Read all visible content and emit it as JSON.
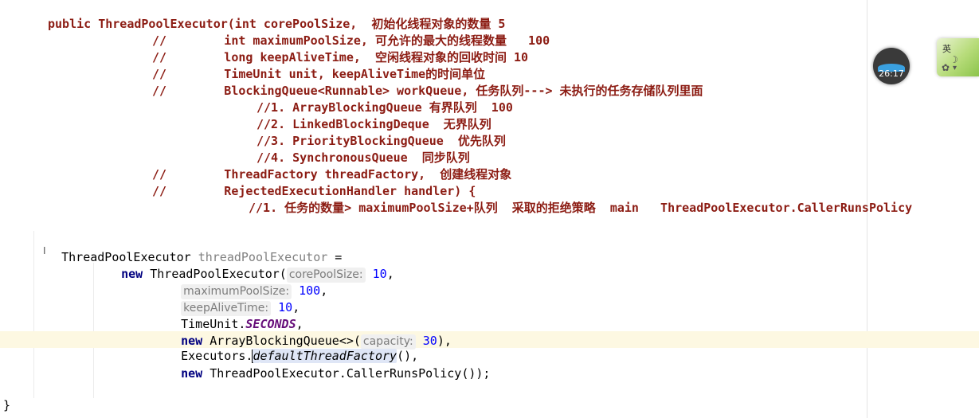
{
  "comment_block": [
    "public ThreadPoolExecutor(int corePoolSize,  初始化线程对象的数量 5",
    "//        int maximumPoolSize, 可允许的最大的线程数量   100",
    "//        long keepAliveTime,  空闲线程对象的回收时间 10",
    "//        TimeUnit unit, keepAliveTime的时间单位",
    "//        BlockingQueue<Runnable> workQueue, 任务队列---> 未执行的任务存储队列里面",
    "//1. ArrayBlockingQueue 有界队列  100",
    "//2. LinkedBlockingDeque  无界队列",
    "//3. PriorityBlockingQueue  优先队列",
    "//4. SynchronousQueue  同步队列",
    "//        ThreadFactory threadFactory,  创建线程对象",
    "//        RejectedExecutionHandler handler) {",
    "//1. 任务的数量> maximumPoolSize+队列  采取的拒绝策略  main   ThreadPoolExecutor.CallerRunsPolicy"
  ],
  "code": {
    "decl_type": "ThreadPoolExecutor",
    "decl_var": "threadPoolExecutor",
    "decl_eq": " =",
    "kw_new": "new",
    "ctor": "ThreadPoolExecutor(",
    "hint_core": "corePoolSize:",
    "val_core": "10",
    "hint_max": "maximumPoolSize:",
    "val_max": "100",
    "hint_keep": "keepAliveTime:",
    "val_keep": "10",
    "timeunit": "TimeUnit.",
    "timeunit_field": "SECONDS",
    "queue_class": "ArrayBlockingQueue<>(",
    "hint_capacity": "capacity:",
    "val_capacity": "30",
    "executors": "Executors.",
    "factory_d": "d",
    "factory_rest": "efaultThreadFactory",
    "policy": "ThreadPoolExecutor.CallerRunsPolicy());",
    "closing_brace": "}"
  },
  "widgets": {
    "timer_text": "26:17",
    "ime_label": "英",
    "ime_moon": "☽",
    "ime_gear": "✿",
    "ime_extra": "▾"
  }
}
